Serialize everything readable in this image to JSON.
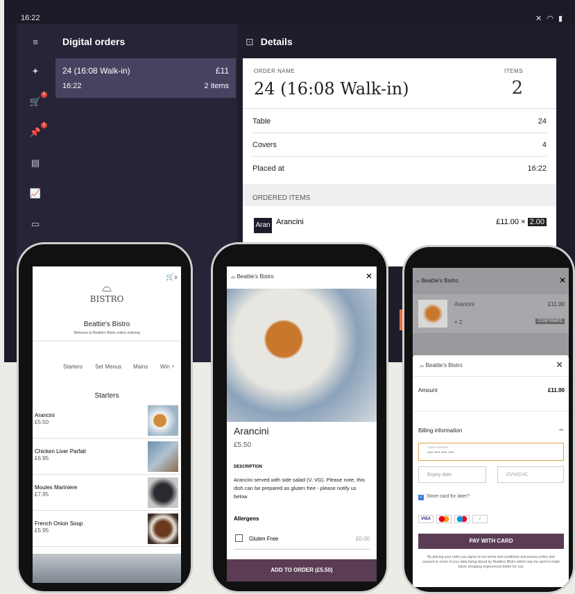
{
  "status_bar": {
    "time": "16:22"
  },
  "rail": {
    "orders_badge": "2",
    "pin_badge": "1"
  },
  "orders_list": {
    "title": "Digital orders",
    "orders": [
      {
        "name": "24 (16:08 Walk-in)",
        "amount": "£11",
        "time": "16:22",
        "count": "2 items"
      }
    ]
  },
  "details": {
    "title": "Details",
    "order_name_label": "ORDER NAME",
    "items_label": "ITEMS",
    "order_name": "24 (16:08 Walk-in)",
    "items_count": "2",
    "rows": [
      {
        "label": "Table",
        "value": "24"
      },
      {
        "label": "Covers",
        "value": "4"
      },
      {
        "label": "Placed at",
        "value": "16:22"
      }
    ],
    "ordered_items_label": "ORDERED ITEMS",
    "item": {
      "thumb": "Aran",
      "name": "Arancini",
      "price": "£11.00 ×",
      "qty": "2.00"
    }
  },
  "phone1": {
    "cart_count": "0",
    "logo_text": "BISTRO",
    "restaurant": "Beattie's Bistro",
    "welcome": "Welcome to Beattie's Bistro online ordering",
    "tabs": [
      "Starters",
      "Set Menus",
      "Mains",
      "Win"
    ],
    "section": "Starters",
    "menu": [
      {
        "name": "Arancini",
        "price": "£5.50"
      },
      {
        "name": "Chicken Liver Parfait",
        "price": "£6.95"
      },
      {
        "name": "Moules Mariniere",
        "price": "£7.95"
      },
      {
        "name": "French Onion Soup",
        "price": "£5.95"
      }
    ]
  },
  "phone2": {
    "header": "Beattie's Bistro",
    "dish": "Arancini",
    "price": "£5.50",
    "description_label": "DESCRIPTION",
    "description": "Arancini served with side salad (V, VG). Please note, this dish can be prepared as gluten free - please notify us below",
    "allergens_label": "Allergens",
    "allergen": "Gluten Free",
    "allergen_price": "£0.00",
    "add_button": "ADD TO ORDER (£5.50)"
  },
  "phone3": {
    "header": "Beattie's Bistro",
    "item_name": "Arancini",
    "item_price": "£11.00",
    "item_qty": "× 2",
    "status": "CONFIRMED",
    "modal_header": "Beattie's Bistro",
    "amount_label": "Amount",
    "amount": "£11.00",
    "billing_label": "Billing information",
    "card_number_label": "CARD NUMBER",
    "card_number_placeholder": "•••• •••• •••• ••••",
    "expiry_placeholder": "Expiry date",
    "cvv_placeholder": "CVV/CVC",
    "store_card": "Store card for later?",
    "card_brands": [
      "VISA",
      "MC",
      "Maestro",
      "AMEX"
    ],
    "pay_button": "PAY WITH CARD",
    "legal": "By placing your order you agree to our terms and conditions and privacy policy and consent to some of your data being stored by Beattie's Bistro which may be used to make future shopping experiences better for you."
  }
}
